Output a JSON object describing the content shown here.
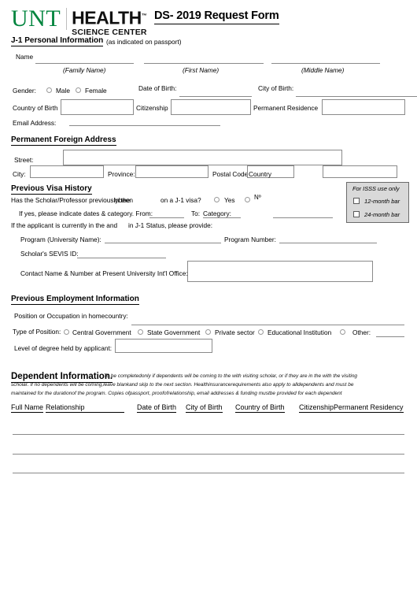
{
  "header": {
    "logo_unt": "UNT",
    "logo_health": "HEALTH",
    "logo_health_tm": "™",
    "logo_science_center": "SCIENCE CENTER",
    "form_title": "DS- 2019 Request Form"
  },
  "personal": {
    "section_title": "J-1 Personal Information",
    "section_note": "(as indicated on passport)",
    "name_label": "Name",
    "family_name": "(Family Name)",
    "first_name": "(First Name)",
    "middle_name": "(Middle Name)",
    "gender_label": "Gender:",
    "male": "Male",
    "female": "Female",
    "date_of_birth": "Date of Birth:",
    "city_of_birth": "City of Birth:",
    "country_of_birth": "Country of Birth",
    "citizenship": "Citizenship",
    "permanent_residence": "Permanent Residence",
    "email_address": "Email Address:"
  },
  "foreign_address": {
    "section_title": "Permanent Foreign Address",
    "street": "Street:",
    "city": "City:",
    "province": "Province:",
    "postal_code": "Postal Code:",
    "country": "Country"
  },
  "visa_history": {
    "section_title": "Previous Visa History",
    "question_part1": "Has the Scholar/Professor previouslybeen",
    "question_part2": "in the",
    "question_part3": "on a J-1 visa?",
    "yes": "Yes",
    "no": "Nº",
    "ifyes_part1": "If yes, please indicate dates & category. From:",
    "ifyes_to": "To:",
    "ifyes_category": "Category:",
    "currently_part1": "If the applicant is currently in the and",
    "currently_part2": "in J-1 Status, please provide:",
    "program_university": "Program (University Name):",
    "program_number": "Program Number:",
    "sevis_id": "Scholar's SEVIS ID:",
    "contact_office": "Contact Name & Number at Present University Int'l Office:"
  },
  "isss": {
    "title": "For  ISSS use only",
    "bar_12": "12-month bar",
    "bar_24": "24-month bar"
  },
  "employment": {
    "section_title": "Previous Employment Information",
    "position_label": "Position or Occupation in homecountry:",
    "type_label": "Type of Position:",
    "options": [
      "Central Government",
      "State Government",
      "Private sector",
      "Educational Institution",
      "Other:"
    ],
    "degree_label": "Level of degree held by applicant:"
  },
  "dependent": {
    "section_title": "Dependent Information.",
    "fine_line1": "To be completedonly   if dependents will be coming to the          with visiting scholar, or if they are in the          with the visiting",
    "fine_line2": "scholar. If no dependents will be coming,leave blankand skip  to the next section. Healthinsurancerequirements also apply  to alldependents and must  be",
    "fine_line3": "maintained for the durationof the program.  Copies ofpassport, proofofrelationship, email addresses & funding  mustbe provided for each     dependent",
    "columns": [
      "Full Name",
      "Relationship",
      "Date of Birth",
      "City of Birth",
      "Country of Birth",
      "Citizenship",
      "Permanent Residency"
    ],
    "row_count": 3
  }
}
